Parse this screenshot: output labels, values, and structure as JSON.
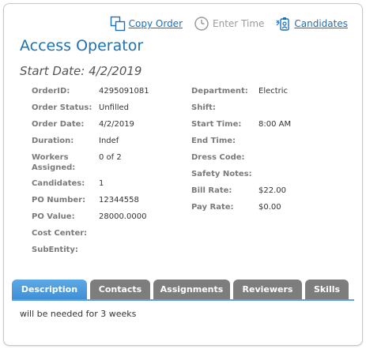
{
  "toolbar": {
    "copy_order": "Copy Order",
    "enter_time": "Enter Time",
    "candidates": "Candidates"
  },
  "header": {
    "title": "Access Operator",
    "start_date": "Start Date: 4/2/2019"
  },
  "details_left": [
    {
      "label": "OrderID:",
      "value": "4295091081"
    },
    {
      "label": "Order Status:",
      "value": "Unfilled"
    },
    {
      "label": "Order Date:",
      "value": "4/2/2019"
    },
    {
      "label": "Duration:",
      "value": "Indef"
    },
    {
      "label": "Workers Assigned:",
      "value": "0 of 2"
    },
    {
      "label": "Candidates:",
      "value": "1"
    },
    {
      "label": "PO Number:",
      "value": "12344558"
    },
    {
      "label": "PO Value:",
      "value": "28000.0000"
    },
    {
      "label": "Cost Center:",
      "value": ""
    },
    {
      "label": "SubEntity:",
      "value": ""
    }
  ],
  "details_right": [
    {
      "label": "Department:",
      "value": "Electric"
    },
    {
      "label": "Shift:",
      "value": ""
    },
    {
      "label": "Start Time:",
      "value": "8:00 AM"
    },
    {
      "label": "End Time:",
      "value": ""
    },
    {
      "label": "Dress Code:",
      "value": ""
    },
    {
      "label": "Safety Notes:",
      "value": ""
    },
    {
      "label": "Bill Rate:",
      "value": "$22.00"
    },
    {
      "label": "Pay Rate:",
      "value": "$0.00"
    }
  ],
  "tabs": [
    {
      "label": "Description",
      "active": true
    },
    {
      "label": "Contacts",
      "active": false
    },
    {
      "label": "Assignments",
      "active": false
    },
    {
      "label": "Reviewers",
      "active": false
    },
    {
      "label": "Skills",
      "active": false
    }
  ],
  "description": "will be needed for 3 weeks",
  "colors": {
    "accent": "#1f72b0",
    "tab_active": "#4a9ad9",
    "tab_inactive": "#7d7d7d"
  }
}
